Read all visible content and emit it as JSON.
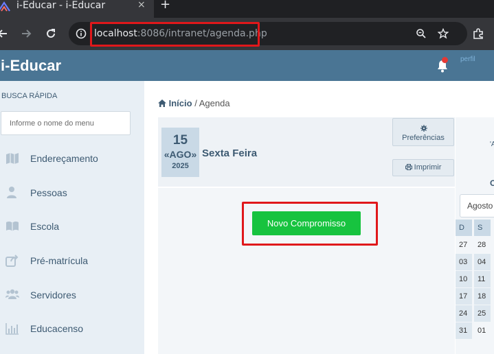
{
  "browser": {
    "tab_title": "i-Educar - i-Educar",
    "tab_close": "×",
    "new_tab": "+",
    "url_host": "localhost",
    "url_rest": ":8086/intranet/agenda.php"
  },
  "header": {
    "brand": "i-Educar",
    "avatar_text": "perfil"
  },
  "sidebar": {
    "search_label": "BUSCA RÁPIDA",
    "search_placeholder": "Informe o nome do menu",
    "items": [
      {
        "label": "Endereçamento",
        "icon": "map-icon"
      },
      {
        "label": "Pessoas",
        "icon": "user-icon"
      },
      {
        "label": "Escola",
        "icon": "book-icon"
      },
      {
        "label": "Pré-matrícula",
        "icon": "share-icon"
      },
      {
        "label": "Servidores",
        "icon": "users-icon"
      },
      {
        "label": "Educacenso",
        "icon": "bar-chart-icon"
      }
    ]
  },
  "breadcrumb": {
    "home": "Início",
    "separator": "/",
    "current": "Agenda"
  },
  "agenda": {
    "day": "15",
    "month": "AGO",
    "prev": "«",
    "next": "»",
    "year": "2025",
    "weekday": "Sexta Feira",
    "preferences_label": "Preferências",
    "print_label": "Imprimir",
    "new_appointment_label": "Novo Compromisso"
  },
  "calendar": {
    "frag_a": "'A",
    "frag_c": "C",
    "month_select": "Agosto",
    "day_headers": [
      "D",
      "S"
    ],
    "weeks": [
      [
        "27",
        "28"
      ],
      [
        "03",
        "04"
      ],
      [
        "10",
        "11"
      ],
      [
        "17",
        "18"
      ],
      [
        "24",
        "25"
      ],
      [
        "31",
        "01"
      ]
    ]
  },
  "colors": {
    "header_bg": "#4a7594",
    "sidebar_bg": "#e8eff5",
    "primary_text": "#3d5a72",
    "success": "#17c33f",
    "highlight_border": "#e0181b"
  }
}
